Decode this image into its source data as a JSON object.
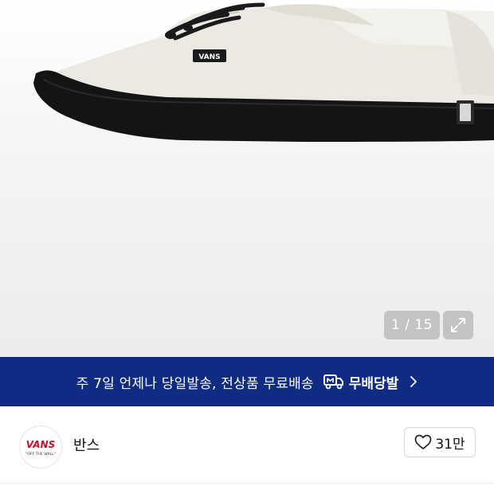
{
  "gallery": {
    "image_alt": "",
    "current_index": "1",
    "total": "15",
    "counter_text": "1 / 15",
    "shoe_logo_text": "VANS",
    "expand_icon": "expand-icon"
  },
  "banner": {
    "text": "주 7일 언제나 당일발송, 전상품 무료배송",
    "brand": "무배당발",
    "icon": "truck-icon",
    "chevron": "chevron-right-icon",
    "background_color": "#0f2c82"
  },
  "shop": {
    "name": "반스",
    "avatar_logo_text": "VANS",
    "avatar_tagline": "\"OFF THE WALL\"",
    "likes": "31만",
    "like_icon": "heart-icon"
  }
}
